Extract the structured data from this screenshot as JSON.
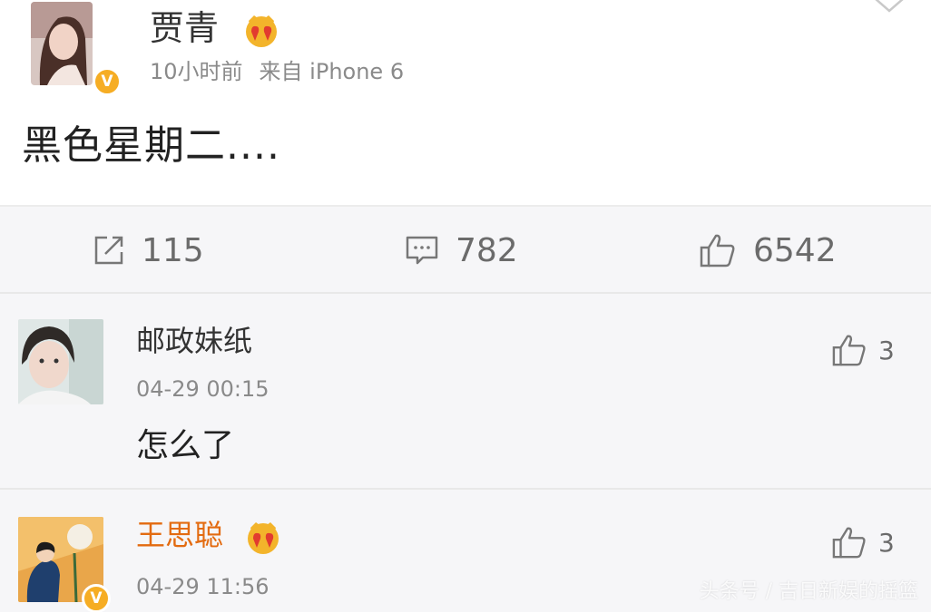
{
  "post": {
    "author": "贾青",
    "time_ago": "10小时前",
    "source": "来自 iPhone 6",
    "text": "黑色星期二....",
    "avatar_icon": "user-avatar-photo",
    "verified_badge": "V",
    "member_icon": "crown-heart-icon"
  },
  "stats": {
    "reposts": "115",
    "comments": "782",
    "likes": "6542"
  },
  "comments": [
    {
      "name": "邮政妹纸",
      "time": "04-29 00:15",
      "text": "怎么了",
      "likes": "3",
      "avatar_icon": "user-avatar-photo"
    },
    {
      "name": "王思聪",
      "time": "04-29 11:56",
      "likes": "3",
      "verified_badge": "V",
      "avatar_icon": "user-avatar-illustration",
      "member_icon": "crown-heart-icon"
    }
  ],
  "watermark": "头条号 / 吉日新娱的摇篮",
  "colors": {
    "vip_name": "#e36b10",
    "badge": "#f6ad24",
    "background_gray": "#f6f6f8"
  }
}
